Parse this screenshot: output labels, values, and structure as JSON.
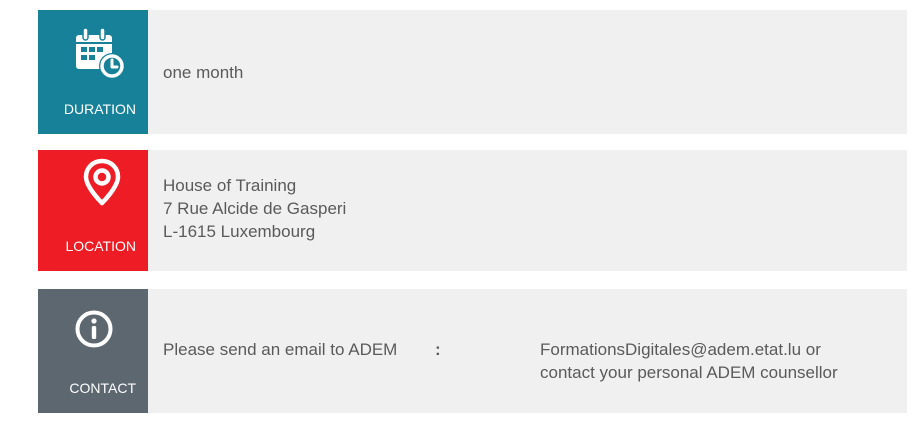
{
  "colors": {
    "duration": "#18819a",
    "location": "#ee1c24",
    "contact": "#5c6770",
    "row_background": "#f0f0f0",
    "text": "#5a5a5a"
  },
  "duration": {
    "icon": "calendar-clock-icon",
    "label": "DURATION",
    "value": "one month"
  },
  "location": {
    "icon": "map-pin-icon",
    "label": "LOCATION",
    "address_lines": [
      "House of Training",
      "7 Rue Alcide de Gasperi",
      "L-1615 Luxembourg"
    ]
  },
  "contact": {
    "icon": "info-circle-icon",
    "label": "CONTACT",
    "lead": "Please send an email to ADEM",
    "separator": ":",
    "detail_lines": [
      "FormationsDigitales@adem.etat.lu or",
      "contact your personal ADEM counsellor"
    ]
  }
}
